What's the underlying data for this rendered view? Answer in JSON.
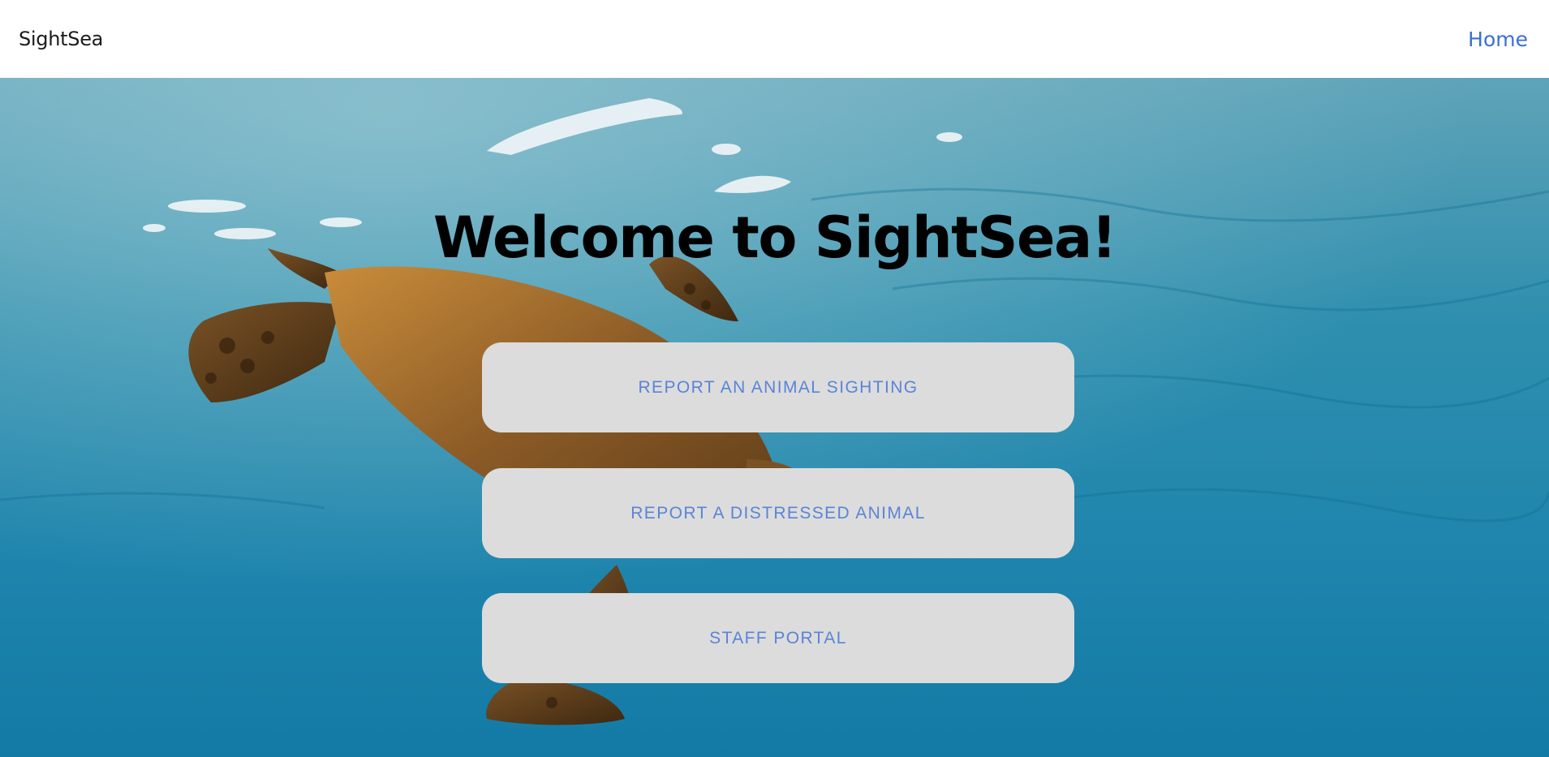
{
  "navbar": {
    "brand": "SightSea",
    "links": [
      {
        "label": "Home"
      }
    ]
  },
  "hero": {
    "title": "Welcome to SightSea!",
    "background_image": "sea-turtle-underwater-photo",
    "buttons": [
      {
        "label": "REPORT AN ANIMAL SIGHTING"
      },
      {
        "label": "REPORT A DISTRESSED ANIMAL"
      },
      {
        "label": "STAFF PORTAL"
      }
    ]
  },
  "colors": {
    "navbar_bg": "#ffffff",
    "link": "#3b6fd4",
    "button_bg": "#dcdcdc",
    "button_text": "#5a84d6",
    "title": "#000000",
    "ocean": "#1f85ad"
  }
}
